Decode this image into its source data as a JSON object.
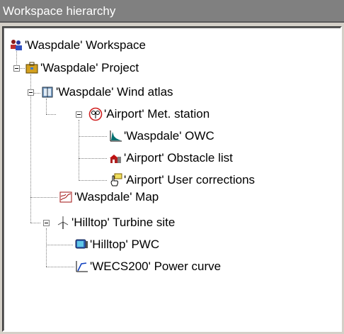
{
  "window": {
    "title": "Workspace hierarchy"
  },
  "tree": {
    "workspace": {
      "label": "'Waspdale' Workspace",
      "icon": "users-icon"
    },
    "project": {
      "label": "'Waspdale' Project",
      "icon": "briefcase-icon"
    },
    "wind_atlas": {
      "label": "'Waspdale' Wind atlas",
      "icon": "book-icon"
    },
    "met_station": {
      "label": "'Airport' Met. station",
      "icon": "anemometer-icon"
    },
    "owc": {
      "label": "'Waspdale' OWC",
      "icon": "histogram-icon"
    },
    "obstacle_list": {
      "label": "'Airport' Obstacle list",
      "icon": "buildings-icon"
    },
    "user_corrections": {
      "label": "'Airport' User corrections",
      "icon": "hand-pointer-icon"
    },
    "map": {
      "label": "'Waspdale' Map",
      "icon": "map-icon"
    },
    "turbine_site": {
      "label": "'Hilltop' Turbine site",
      "icon": "turbine-icon"
    },
    "pwc": {
      "label": "'Hilltop' PWC",
      "icon": "monitor-icon"
    },
    "power_curve": {
      "label": "'WECS200' Power curve",
      "icon": "curve-chart-icon"
    }
  }
}
